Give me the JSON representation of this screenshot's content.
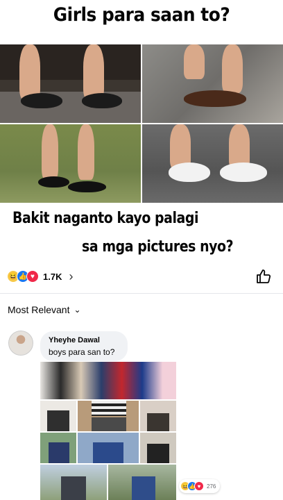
{
  "meme": {
    "title": "Girls para saan to?",
    "caption_line1": "Bakit naganto kayo palagi",
    "caption_line2": "sa mga pictures nyo?"
  },
  "post_reactions": {
    "icons": [
      "haha-icon",
      "like-icon",
      "love-icon"
    ],
    "count": "1.7K",
    "chevron": "›"
  },
  "comments_header": {
    "sort_label": "Most Relevant",
    "chevron": "⌄"
  },
  "comment": {
    "author": "Yheyhe Dawal",
    "text": "boys para san to?",
    "reaction_count": "276"
  },
  "colors": {
    "like_blue": "#1877f2",
    "love_red": "#f02849",
    "haha_yellow": "#f7c948",
    "bubble_bg": "#f0f2f5"
  }
}
